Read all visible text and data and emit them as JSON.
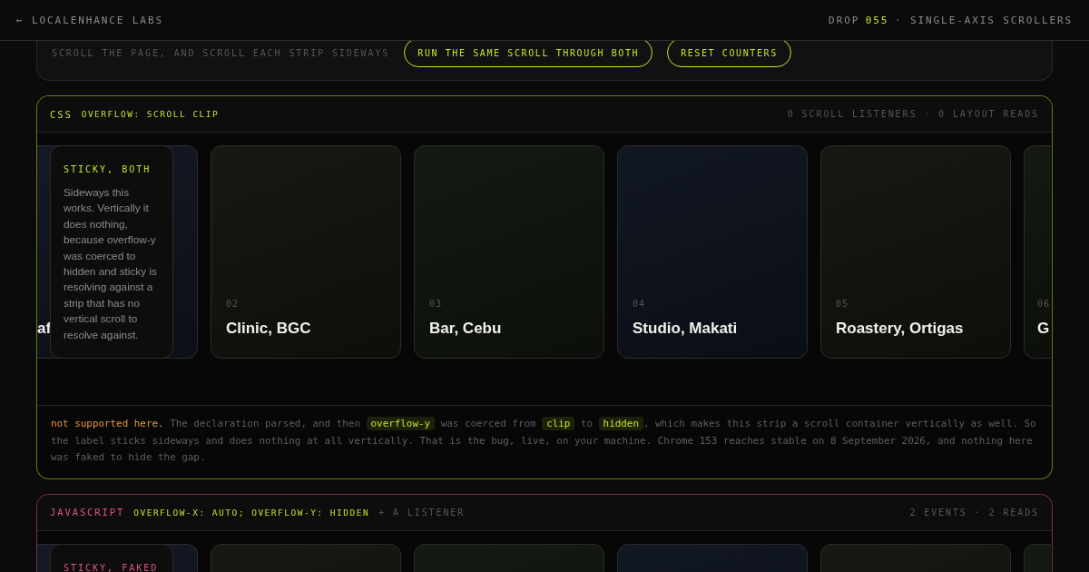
{
  "topbar": {
    "back_link": "← LOCALENHANCE LABS",
    "drop_label": "DROP",
    "drop_number": "055",
    "drop_title": "· SINGLE-AXIS SCROLLERS"
  },
  "controls": {
    "hint": "SCROLL THE PAGE, AND SCROLL EACH STRIP SIDEWAYS",
    "buttons": [
      "RUN THE SAME SCROLL THROUGH BOTH",
      "RESET COUNTERS"
    ]
  },
  "panels": [
    {
      "tag": "CSS",
      "color": "#c6e02a",
      "code": "OVERFLOW: SCROLL CLIP",
      "stats": "0 SCROLL LISTENERS · 0 LAYOUT READS",
      "sticky": {
        "label": "STICKY, BOTH",
        "body": "Sideways this works. Vertically it does nothing, because overflow-y was coerced to hidden and sticky is resolving against a strip that has no vertical scroll to resolve against."
      },
      "cards": [
        {
          "kind": "cut-left",
          "title": "af",
          "color": "#111722"
        },
        {
          "kind": "full",
          "number": "02",
          "title": "Clinic, BGC",
          "color": "#15160f"
        },
        {
          "kind": "full",
          "number": "03",
          "title": "Bar, Cebu",
          "color": "#121710"
        },
        {
          "kind": "full",
          "number": "04",
          "title": "Studio, Makati",
          "color": "#0f1520"
        },
        {
          "kind": "full",
          "number": "05",
          "title": "Roastery, Ortigas",
          "color": "#15160f"
        },
        {
          "kind": "cut-right",
          "number": "06",
          "title": "G",
          "color": "#121710"
        }
      ],
      "note": [
        {
          "kind": "lead",
          "text": "not supported here."
        },
        {
          "kind": "text",
          "text": " The declaration parsed, and then "
        },
        {
          "kind": "code",
          "text": "overflow-y"
        },
        {
          "kind": "text",
          "text": " was coerced from "
        },
        {
          "kind": "code",
          "text": "clip"
        },
        {
          "kind": "text",
          "text": " to "
        },
        {
          "kind": "code",
          "text": "hidden"
        },
        {
          "kind": "text",
          "text": ", which makes this strip a scroll container vertically as well. So the label sticks sideways and does nothing at all vertically. That is the bug, live, on your machine. Chrome 153 reaches stable on 8 September 2026, and nothing here was faked to hide the gap."
        }
      ]
    },
    {
      "tag": "JAVASCRIPT",
      "color": "#e0508f",
      "code": "OVERFLOW-X: AUTO; OVERFLOW-Y: HIDDEN",
      "suffix": "+ A LISTENER",
      "stats": "2 EVENTS · 2 READS",
      "sticky": {
        "label": "STICKY, FAKED"
      },
      "cards": [
        {
          "kind": "cut-left",
          "color": "#111722"
        },
        {
          "kind": "full",
          "color": "#15160f"
        },
        {
          "kind": "full",
          "color": "#121710"
        },
        {
          "kind": "full",
          "color": "#0f1520"
        },
        {
          "kind": "full",
          "color": "#15160f"
        },
        {
          "kind": "cut-right",
          "color": "#121710"
        }
      ]
    }
  ]
}
